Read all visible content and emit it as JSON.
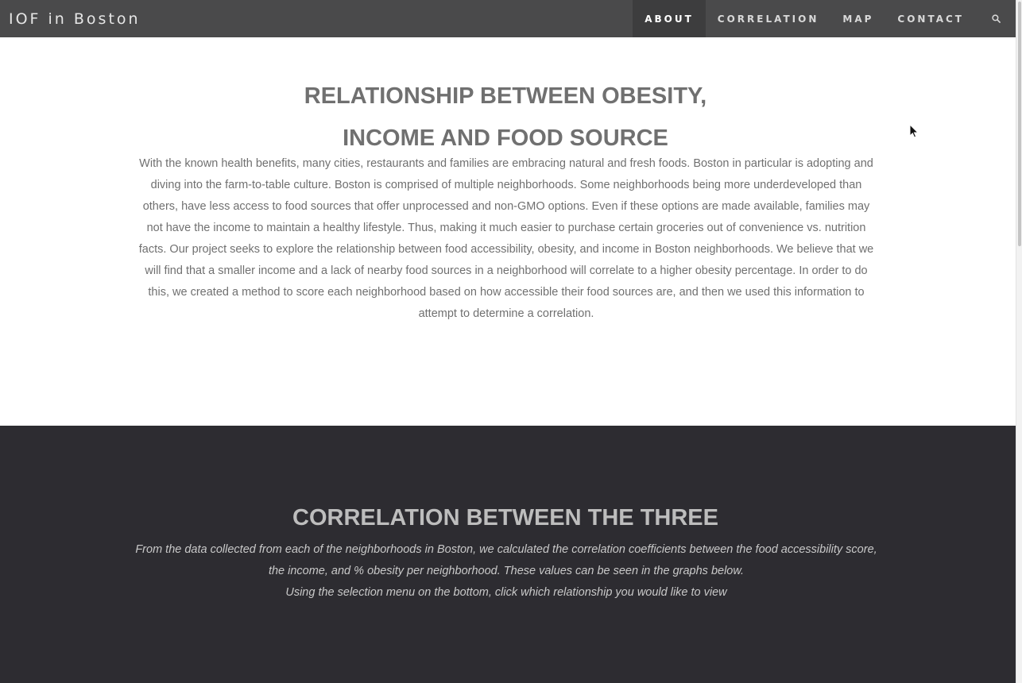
{
  "navbar": {
    "brand": "IOF in Boston",
    "items": [
      {
        "label": "ABOUT",
        "active": true
      },
      {
        "label": "CORRELATION",
        "active": false
      },
      {
        "label": "MAP",
        "active": false
      },
      {
        "label": "CONTACT",
        "active": false
      }
    ],
    "search_icon": "search-icon"
  },
  "about": {
    "title_line1": "RELATIONSHIP BETWEEN OBESITY,",
    "title_line2": "INCOME AND FOOD SOURCE",
    "body": "With the known health benefits, many cities, restaurants and families are embracing natural and fresh foods. Boston in particular is adopting and diving into the farm-to-table culture. Boston is comprised of multiple neighborhoods. Some neighborhoods being more underdeveloped than others, have less access to food sources that offer unprocessed and non-GMO options. Even if these options are made available, families may not have the income to maintain a healthy lifestyle. Thus, making it much easier to purchase certain groceries out of convenience vs. nutrition facts. Our project seeks to explore the relationship between food accessibility, obesity, and income in Boston neighborhoods. We believe that we will find that a smaller income and a lack of nearby food sources in a neighborhood will correlate to a higher obesity percentage. In order to do this, we created a method to score each neighborhood based on how accessible their food sources are, and then we used this information to attempt to determine a correlation."
  },
  "correlation": {
    "title": "CORRELATION BETWEEN THE THREE",
    "text_line1": "From the data collected from each of the neighborhoods in Boston, we calculated the correlation coefficients between the food accessibility score, the income, and % obesity per neighborhood. These values can be seen in the graphs below.",
    "text_line2": "Using the selection menu on the bottom, click which relationship you would like to view"
  },
  "colors": {
    "navbar_bg": "#4a4a4b",
    "nav_active_bg": "#3d3d3e",
    "dark_section_bg": "#2d2c31",
    "heading_gray": "#707070"
  }
}
